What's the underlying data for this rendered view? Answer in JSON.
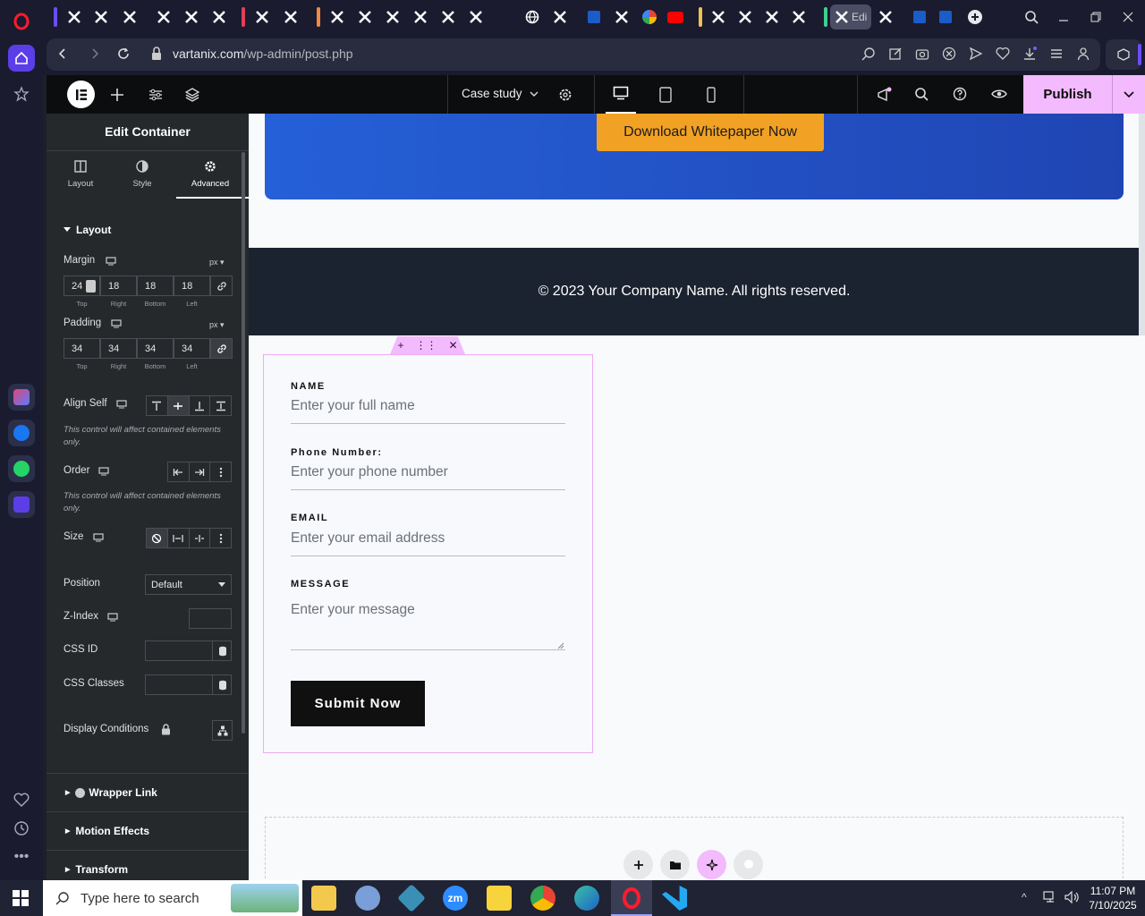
{
  "browser": {
    "url_domain": "vartanix.com",
    "url_path": "/wp-admin/post.php",
    "active_tab_title": "Edi"
  },
  "elementor": {
    "page_name": "Case study",
    "publish_label": "Publish"
  },
  "panel": {
    "title": "Edit Container",
    "tabs": [
      {
        "label": "Layout",
        "icon": "layout-icon"
      },
      {
        "label": "Style",
        "icon": "style-icon"
      },
      {
        "label": "Advanced",
        "icon": "gear-icon"
      }
    ],
    "active_tab": "Advanced",
    "layout_section": "Layout",
    "margin": {
      "label": "Margin",
      "unit": "px",
      "values": [
        "24",
        "18",
        "18",
        "18"
      ]
    },
    "padding": {
      "label": "Padding",
      "unit": "px",
      "values": [
        "34",
        "34",
        "34",
        "34"
      ]
    },
    "sides": [
      "Top",
      "Right",
      "Bottom",
      "Left"
    ],
    "align_self": {
      "label": "Align Self",
      "note": "This control will affect contained elements only."
    },
    "order": {
      "label": "Order",
      "note": "This control will affect contained elements only."
    },
    "size": {
      "label": "Size"
    },
    "position": {
      "label": "Position",
      "value": "Default"
    },
    "zindex": {
      "label": "Z-Index"
    },
    "css_id": {
      "label": "CSS ID"
    },
    "css_classes": {
      "label": "CSS Classes"
    },
    "display_conditions": {
      "label": "Display Conditions"
    },
    "sections": [
      "Wrapper Link",
      "Motion Effects",
      "Transform"
    ]
  },
  "canvas": {
    "download_button": "Download Whitepaper Now",
    "footer_text": "© 2023 Your Company Name. All rights reserved.",
    "form": {
      "fields": [
        {
          "label": "NAME",
          "placeholder": "Enter your full name"
        },
        {
          "label": "Phone Number:",
          "placeholder": "Enter your phone number"
        },
        {
          "label": "EMAIL",
          "placeholder": "Enter your email address"
        },
        {
          "label": "MESSAGE",
          "placeholder": "Enter your message"
        }
      ],
      "submit": "Submit Now"
    }
  },
  "taskbar": {
    "search_placeholder": "Type here to search",
    "time": "11:07 PM",
    "date": "7/10/2025"
  },
  "colors": {
    "accent_pink": "#f3bafd",
    "hero_blue": "#2560d8",
    "download_orange": "#f1a124",
    "footer_navy": "#1b2230"
  }
}
